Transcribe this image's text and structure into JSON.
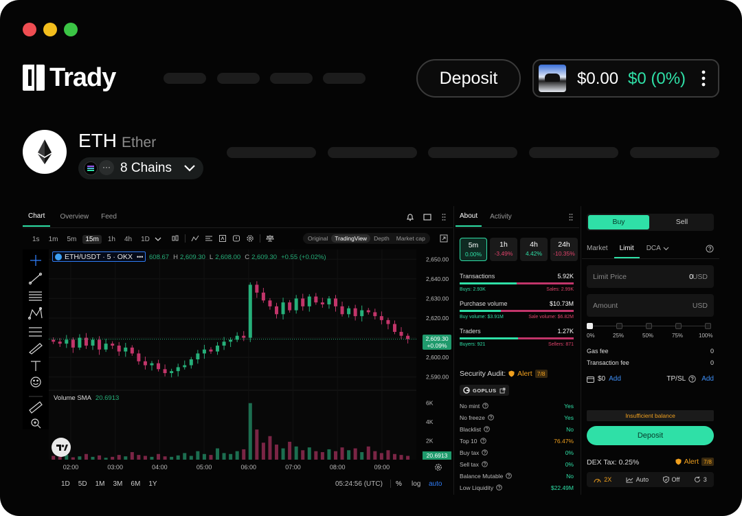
{
  "brand": {
    "name": "Trady"
  },
  "colors": {
    "accent": "#2fe0a7",
    "up": "#26b07a",
    "down": "#c2356a",
    "bg": "#050505"
  },
  "header": {
    "deposit_label": "Deposit",
    "wallet": {
      "balance": "$0.00",
      "change": "$0 (0%)",
      "menu_icon": "more-vertical-icon"
    }
  },
  "token": {
    "symbol": "ETH",
    "name": "Ether",
    "chains_label": "8 Chains",
    "chains_more": "···"
  },
  "chart_tabs": [
    {
      "label": "Chart"
    },
    {
      "label": "Overview"
    },
    {
      "label": "Feed"
    }
  ],
  "timeframes": [
    "1s",
    "1m",
    "5m",
    "15m",
    "1h",
    "4h",
    "1D"
  ],
  "active_timeframe": "15m",
  "view_modes": [
    "Original",
    "TradingView",
    "Depth",
    "Market cap"
  ],
  "active_view_mode": "TradingView",
  "chart": {
    "pair_label": "ETH/USDT · 5 · OKX",
    "more": "•••",
    "ohlc": {
      "o_val": "608.67",
      "h_key": "H",
      "h_val": "2,609.30",
      "l_key": "L",
      "l_val": "2,608.00",
      "c_key": "C",
      "c_val": "2,609.30",
      "chg": "+0.55 (+0.02%)"
    },
    "price_ticks": [
      "2,650.00",
      "2,640.00",
      "2,630.00",
      "2,620.00",
      "2,610.00",
      "2,600.00",
      "2,590.00"
    ],
    "current_price": "2,609.30",
    "current_change": "+0.09%",
    "volume_label": "Volume SMA",
    "volume_value": "20.6913",
    "volume_ticks": [
      "6K",
      "4K",
      "2K"
    ],
    "time_ticks": [
      "02:00",
      "03:00",
      "04:00",
      "05:00",
      "06:00",
      "07:00",
      "08:00",
      "09:00"
    ],
    "ranges": [
      "1D",
      "5D",
      "1M",
      "3M",
      "6M",
      "1Y"
    ],
    "clock": "05:24:56 (UTC)",
    "pct_label": "%",
    "log_label": "log",
    "auto_label": "auto"
  },
  "chart_data": {
    "type": "candlestick",
    "title": "ETH/USDT · 5 · OKX",
    "x_range": [
      "01:36",
      "09:10"
    ],
    "ylim": [
      2585,
      2655
    ],
    "y_ticks": [
      2590,
      2600,
      2610,
      2620,
      2630,
      2640,
      2650
    ],
    "x_ticks": [
      "02:00",
      "03:00",
      "04:00",
      "05:00",
      "06:00",
      "07:00",
      "08:00",
      "09:00"
    ],
    "close_series": [
      2608,
      2607,
      2609,
      2605,
      2610,
      2606,
      2609,
      2604,
      2607,
      2606,
      2603,
      2605,
      2602,
      2598,
      2596,
      2597,
      2594,
      2592,
      2593,
      2595,
      2596,
      2599,
      2602,
      2604,
      2603,
      2606,
      2608,
      2609,
      2611,
      2610,
      2637,
      2633,
      2629,
      2626,
      2622,
      2628,
      2624,
      2630,
      2626,
      2631,
      2628,
      2627,
      2630,
      2626,
      2622,
      2625,
      2621,
      2624,
      2623,
      2621,
      2619,
      2617,
      2613,
      2611,
      2609.3
    ],
    "volume_ylim": [
      0,
      7000
    ],
    "volume_series": [
      400,
      300,
      500,
      250,
      350,
      600,
      300,
      450,
      200,
      300,
      500,
      350,
      800,
      500,
      400,
      300,
      600,
      350,
      300,
      450,
      700,
      400,
      900,
      600,
      500,
      1200,
      700,
      600,
      900,
      1100,
      6000,
      3200,
      1800,
      2500,
      1600,
      1200,
      1900,
      1400,
      1000,
      1300,
      900,
      800,
      1100,
      900,
      1300,
      1000,
      1200,
      800,
      1400,
      900,
      700,
      1000,
      600,
      500,
      400
    ]
  },
  "about": {
    "tabs": [
      "About",
      "Activity"
    ],
    "periods": [
      {
        "label": "5m",
        "change": "0.00%",
        "tone": "neutral"
      },
      {
        "label": "1h",
        "change": "-3.49%",
        "tone": "down"
      },
      {
        "label": "4h",
        "change": "4.42%",
        "tone": "up"
      },
      {
        "label": "24h",
        "change": "-10.35%",
        "tone": "down"
      }
    ],
    "stats": [
      {
        "label": "Transactions",
        "value": "5.92K",
        "left": "Buys: 2.93K",
        "right": "Sales: 2.99K",
        "ratio": 0.5
      },
      {
        "label": "Purchase volume",
        "value": "$10.73M",
        "left": "Buy volume: $3.91M",
        "right": "Sale volume: $6.82M",
        "ratio": 0.36
      },
      {
        "label": "Traders",
        "value": "1.27K",
        "left": "Buyers: 921",
        "right": "Sellers: 871",
        "ratio": 0.51
      }
    ],
    "security": {
      "title": "Security Audit:",
      "alert_label": "Alert",
      "alert_count": "7/8",
      "provider": "GOPLUS",
      "rows": [
        {
          "label": "No mint",
          "value": "Yes",
          "tone": "up"
        },
        {
          "label": "No freeze",
          "value": "Yes",
          "tone": "up"
        },
        {
          "label": "Blacklist",
          "value": "No",
          "tone": "up"
        },
        {
          "label": "Top 10",
          "value": "76.47%",
          "tone": "warn"
        },
        {
          "label": "Buy tax",
          "value": "0%",
          "tone": "up"
        },
        {
          "label": "Sell tax",
          "value": "0%",
          "tone": "up"
        },
        {
          "label": "Balance Mutable",
          "value": "No",
          "tone": "up"
        },
        {
          "label": "Low Liquidity",
          "value": "$22.49M",
          "tone": "up"
        }
      ]
    }
  },
  "trade": {
    "buy_label": "Buy",
    "sell_label": "Sell",
    "order_tabs": [
      "Market",
      "Limit",
      "DCA"
    ],
    "active_order_tab": "Limit",
    "limit_price_label": "Limit Price",
    "limit_price_value": "0",
    "limit_price_unit": "USD",
    "amount_label": "Amount",
    "amount_unit": "USD",
    "slider_marks": [
      "0%",
      "25%",
      "50%",
      "75%",
      "100%"
    ],
    "slider_value": 0,
    "gas_fee_label": "Gas fee",
    "gas_fee_value": "0",
    "tx_fee_label": "Transaction fee",
    "tx_fee_value": "0",
    "balance": "$0",
    "add_label": "Add",
    "tpsl_label": "TP/SL",
    "tpsl_add": "Add",
    "insufficient": "Insufficient balance",
    "deposit_label": "Deposit",
    "dex_tax": "DEX Tax: 0.25%",
    "alert_label": "Alert",
    "alert_count": "7/8",
    "footer": [
      {
        "label": "2X",
        "icon": "speed-icon"
      },
      {
        "label": "Auto",
        "icon": "chart-line-icon"
      },
      {
        "label": "Off",
        "icon": "shield-icon"
      },
      {
        "label": "3",
        "icon": "refresh-icon"
      }
    ]
  }
}
